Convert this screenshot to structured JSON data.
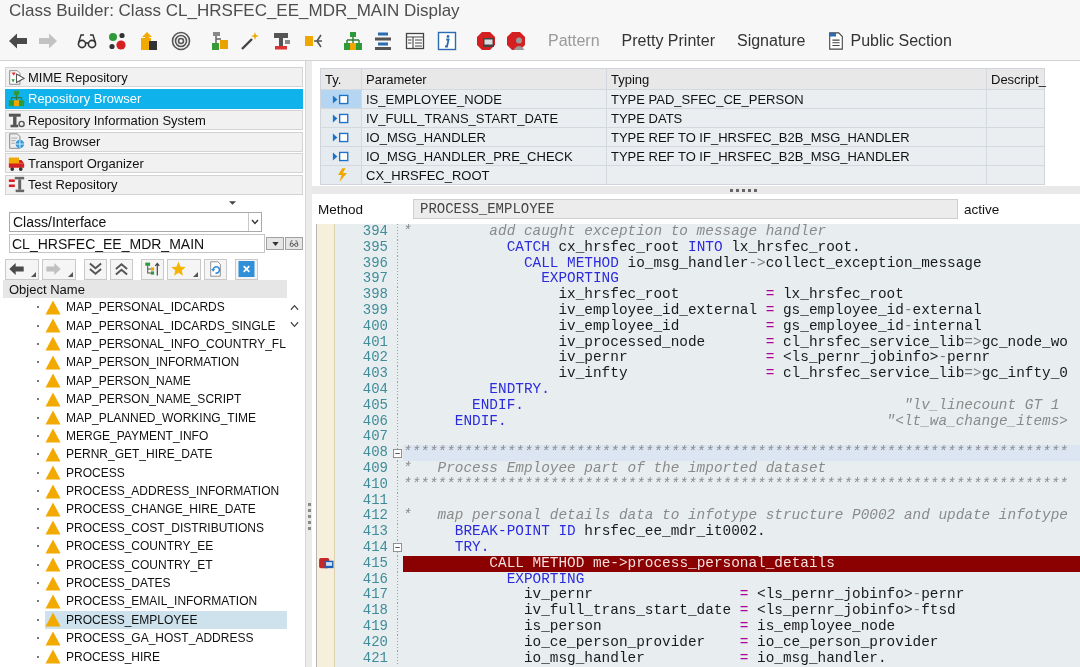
{
  "window": {
    "title": "Class Builder: Class CL_HRSFEC_EE_MDR_MAIN Display"
  },
  "toolbar": [
    {
      "kind": "icon",
      "disabled": false
    },
    {
      "kind": "icon",
      "disabled": true
    },
    {
      "kind": "icon",
      "disabled": false
    },
    {
      "kind": "icon",
      "disabled": false
    },
    {
      "kind": "icon",
      "disabled": false
    },
    {
      "kind": "icon",
      "disabled": false
    },
    {
      "kind": "icon",
      "disabled": false
    },
    {
      "kind": "icon",
      "disabled": false
    },
    {
      "kind": "icon",
      "disabled": false
    },
    {
      "kind": "icon",
      "disabled": false
    },
    {
      "kind": "icon",
      "disabled": false
    },
    {
      "kind": "icon",
      "disabled": false
    },
    {
      "kind": "icon",
      "disabled": false
    },
    {
      "kind": "icon",
      "disabled": false
    },
    {
      "kind": "icon",
      "disabled": false
    },
    {
      "kind": "icon",
      "disabled": false
    },
    {
      "kind": "text",
      "label": "Pattern",
      "disabled": true
    },
    {
      "kind": "text",
      "label": "Pretty Printer",
      "disabled": false
    },
    {
      "kind": "text",
      "label": "Signature",
      "disabled": false
    },
    {
      "kind": "icon-text",
      "label": "Public Section",
      "disabled": false
    }
  ],
  "navigator": {
    "items": [
      {
        "label": "MIME Repository",
        "selected": false
      },
      {
        "label": "Repository Browser",
        "selected": true
      },
      {
        "label": "Repository Information System",
        "selected": false
      },
      {
        "label": "Tag Browser",
        "selected": false
      },
      {
        "label": "Transport Organizer",
        "selected": false
      },
      {
        "label": "Test Repository",
        "selected": false
      }
    ],
    "object_type": "Class/Interface",
    "object_name": "CL_HRSFEC_EE_MDR_MAIN",
    "toolbar": [
      {
        "disabled": false
      },
      {
        "disabled": true
      },
      {
        "disabled": false
      },
      {
        "disabled": false
      },
      {
        "disabled": false
      },
      {
        "disabled": false
      },
      {
        "disabled": false
      },
      {
        "disabled": false
      }
    ]
  },
  "tree": {
    "header": "Object Name",
    "items": [
      {
        "label": "MAP_PERSONAL_IDCARDS",
        "selected": false
      },
      {
        "label": "MAP_PERSONAL_IDCARDS_SINGLE",
        "selected": false
      },
      {
        "label": "MAP_PERSONAL_INFO_COUNTRY_FL",
        "selected": false
      },
      {
        "label": "MAP_PERSON_INFORMATION",
        "selected": false
      },
      {
        "label": "MAP_PERSON_NAME",
        "selected": false
      },
      {
        "label": "MAP_PERSON_NAME_SCRIPT",
        "selected": false
      },
      {
        "label": "MAP_PLANNED_WORKING_TIME",
        "selected": false
      },
      {
        "label": "MERGE_PAYMENT_INFO",
        "selected": false
      },
      {
        "label": "PERNR_GET_HIRE_DATE",
        "selected": false
      },
      {
        "label": "PROCESS",
        "selected": false
      },
      {
        "label": "PROCESS_ADDRESS_INFORMATION",
        "selected": false
      },
      {
        "label": "PROCESS_CHANGE_HIRE_DATE",
        "selected": false
      },
      {
        "label": "PROCESS_COST_DISTRIBUTIONS",
        "selected": false
      },
      {
        "label": "PROCESS_COUNTRY_EE",
        "selected": false
      },
      {
        "label": "PROCESS_COUNTRY_ET",
        "selected": false
      },
      {
        "label": "PROCESS_DATES",
        "selected": false
      },
      {
        "label": "PROCESS_EMAIL_INFORMATION",
        "selected": false
      },
      {
        "label": "PROCESS_EMPLOYEE",
        "selected": true
      },
      {
        "label": "PROCESS_GA_HOST_ADDRESS",
        "selected": false
      },
      {
        "label": "PROCESS_HIRE",
        "selected": false
      }
    ]
  },
  "parameters": {
    "columns": [
      "Ty.",
      "Parameter",
      "Typing",
      "Descript_"
    ],
    "rows": [
      {
        "kind": "importing",
        "selected": true,
        "parameter": "IS_EMPLOYEE_NODE",
        "typing": "TYPE PAD_SFEC_CE_PERSON"
      },
      {
        "kind": "importing",
        "selected": false,
        "parameter": "IV_FULL_TRANS_START_DATE",
        "typing": "TYPE DATS"
      },
      {
        "kind": "importing",
        "selected": false,
        "parameter": "IO_MSG_HANDLER",
        "typing": "TYPE REF TO IF_HRSFEC_B2B_MSG_HANDLER"
      },
      {
        "kind": "importing",
        "selected": false,
        "parameter": "IO_MSG_HANDLER_PRE_CHECK",
        "typing": "TYPE REF TO IF_HRSFEC_B2B_MSG_HANDLER"
      },
      {
        "kind": "exception",
        "selected": false,
        "parameter": "CX_HRSFEC_ROOT"
      }
    ]
  },
  "method": {
    "label": "Method",
    "value": "PROCESS_EMPLOYEE",
    "status": "active"
  },
  "editor": {
    "lines": [
      {
        "number": "394",
        "current": false,
        "breakpoint": false,
        "toggle": false,
        "segments": [
          {
            "kind": "comment",
            "text": "*         add caught exception to message handler"
          }
        ]
      },
      {
        "number": "395",
        "current": false,
        "breakpoint": false,
        "toggle": false,
        "segments": [
          {
            "kind": "keyword",
            "text": "            CATCH"
          },
          {
            "kind": "plain",
            "text": " cx_hrsfec_root "
          },
          {
            "kind": "keyword",
            "text": "INTO"
          },
          {
            "kind": "plain",
            "text": " lx_hrsfec_root."
          }
        ]
      },
      {
        "number": "396",
        "current": false,
        "breakpoint": false,
        "toggle": false,
        "segments": [
          {
            "kind": "keyword",
            "text": "              CALL METHOD"
          },
          {
            "kind": "plain",
            "text": " io_msg_handler"
          },
          {
            "kind": "symbol",
            "text": "->"
          },
          {
            "kind": "plain",
            "text": "collect_exception_message"
          }
        ]
      },
      {
        "number": "397",
        "current": false,
        "breakpoint": false,
        "toggle": false,
        "segments": [
          {
            "kind": "keyword",
            "text": "                EXPORTING"
          }
        ]
      },
      {
        "number": "398",
        "current": false,
        "breakpoint": false,
        "toggle": false,
        "segments": [
          {
            "kind": "plain",
            "text": "                  ix_hrsfec_root          "
          },
          {
            "kind": "operator",
            "text": "="
          },
          {
            "kind": "plain",
            "text": " lx_hrsfec_root"
          }
        ]
      },
      {
        "number": "399",
        "current": false,
        "breakpoint": false,
        "toggle": false,
        "segments": [
          {
            "kind": "plain",
            "text": "                  iv_employee_id_external "
          },
          {
            "kind": "operator",
            "text": "="
          },
          {
            "kind": "plain",
            "text": " gs_employee_id"
          },
          {
            "kind": "symbol",
            "text": "-"
          },
          {
            "kind": "plain",
            "text": "external"
          }
        ]
      },
      {
        "number": "400",
        "current": false,
        "breakpoint": false,
        "toggle": false,
        "segments": [
          {
            "kind": "plain",
            "text": "                  iv_employee_id          "
          },
          {
            "kind": "operator",
            "text": "="
          },
          {
            "kind": "plain",
            "text": " gs_employee_id"
          },
          {
            "kind": "symbol",
            "text": "-"
          },
          {
            "kind": "plain",
            "text": "internal"
          }
        ]
      },
      {
        "number": "401",
        "current": false,
        "breakpoint": false,
        "toggle": false,
        "segments": [
          {
            "kind": "plain",
            "text": "                  iv_processed_node       "
          },
          {
            "kind": "operator",
            "text": "="
          },
          {
            "kind": "plain",
            "text": " cl_hrsfec_service_lib"
          },
          {
            "kind": "symbol",
            "text": "=>"
          },
          {
            "kind": "plain",
            "text": "gc_node_wo"
          }
        ]
      },
      {
        "number": "402",
        "current": false,
        "breakpoint": false,
        "toggle": false,
        "segments": [
          {
            "kind": "plain",
            "text": "                  iv_pernr                "
          },
          {
            "kind": "operator",
            "text": "="
          },
          {
            "kind": "plain",
            "text": " <ls_pernr_jobinfo>"
          },
          {
            "kind": "symbol",
            "text": "-"
          },
          {
            "kind": "plain",
            "text": "pernr"
          }
        ]
      },
      {
        "number": "403",
        "current": false,
        "breakpoint": false,
        "toggle": false,
        "segments": [
          {
            "kind": "plain",
            "text": "                  iv_infty                "
          },
          {
            "kind": "operator",
            "text": "="
          },
          {
            "kind": "plain",
            "text": " cl_hrsfec_service_lib"
          },
          {
            "kind": "symbol",
            "text": "=>"
          },
          {
            "kind": "plain",
            "text": "gc_infty_0"
          }
        ]
      },
      {
        "number": "404",
        "current": false,
        "breakpoint": false,
        "toggle": false,
        "segments": [
          {
            "kind": "keyword",
            "text": "          ENDTRY."
          }
        ]
      },
      {
        "number": "405",
        "current": false,
        "breakpoint": false,
        "toggle": false,
        "segments": [
          {
            "kind": "keyword",
            "text": "        ENDIF."
          },
          {
            "kind": "comment",
            "text": "                                            \"lv_linecount GT 1"
          }
        ]
      },
      {
        "number": "406",
        "current": false,
        "breakpoint": false,
        "toggle": false,
        "segments": [
          {
            "kind": "keyword",
            "text": "      ENDIF."
          },
          {
            "kind": "comment",
            "text": "                                            \"<lt_wa_change_items>"
          }
        ]
      },
      {
        "number": "407",
        "current": false,
        "breakpoint": false,
        "toggle": false
      },
      {
        "number": "408",
        "current": true,
        "breakpoint": false,
        "toggle": true,
        "segments": [
          {
            "kind": "comment",
            "text": "*****************************************************************************"
          }
        ]
      },
      {
        "number": "409",
        "current": false,
        "breakpoint": false,
        "toggle": false,
        "segments": [
          {
            "kind": "comment",
            "text": "*   Process Employee part of the imported dataset"
          }
        ]
      },
      {
        "number": "410",
        "current": false,
        "breakpoint": false,
        "toggle": false,
        "segments": [
          {
            "kind": "comment",
            "text": "*****************************************************************************"
          }
        ]
      },
      {
        "number": "411",
        "current": false,
        "breakpoint": false,
        "toggle": false
      },
      {
        "number": "412",
        "current": false,
        "breakpoint": false,
        "toggle": false,
        "segments": [
          {
            "kind": "comment",
            "text": "*   map personal details data to infotype structure P0002 and update infotype"
          }
        ]
      },
      {
        "number": "413",
        "current": false,
        "breakpoint": false,
        "toggle": false,
        "segments": [
          {
            "kind": "keyword",
            "text": "      BREAK-POINT ID"
          },
          {
            "kind": "plain",
            "text": " hrsfec_ee_mdr_it0002."
          }
        ]
      },
      {
        "number": "414",
        "current": false,
        "breakpoint": false,
        "toggle": true,
        "segments": [
          {
            "kind": "keyword",
            "text": "      TRY."
          }
        ]
      },
      {
        "number": "415",
        "current": false,
        "breakpoint": true,
        "toggle": false,
        "segments": [
          {
            "kind": "keyword",
            "text": "          CALL METHOD"
          },
          {
            "kind": "plain",
            "text": " me"
          },
          {
            "kind": "symbol",
            "text": "->"
          },
          {
            "kind": "plain",
            "text": "process_personal_details"
          }
        ]
      },
      {
        "number": "416",
        "current": false,
        "breakpoint": false,
        "toggle": false,
        "segments": [
          {
            "kind": "keyword",
            "text": "            EXPORTING"
          }
        ]
      },
      {
        "number": "417",
        "current": false,
        "breakpoint": false,
        "toggle": false,
        "segments": [
          {
            "kind": "plain",
            "text": "              iv_pernr                 "
          },
          {
            "kind": "operator",
            "text": "="
          },
          {
            "kind": "plain",
            "text": " <ls_pernr_jobinfo>"
          },
          {
            "kind": "symbol",
            "text": "-"
          },
          {
            "kind": "plain",
            "text": "pernr"
          }
        ]
      },
      {
        "number": "418",
        "current": false,
        "breakpoint": false,
        "toggle": false,
        "segments": [
          {
            "kind": "plain",
            "text": "              iv_full_trans_start_date "
          },
          {
            "kind": "operator",
            "text": "="
          },
          {
            "kind": "plain",
            "text": " <ls_pernr_jobinfo>"
          },
          {
            "kind": "symbol",
            "text": "-"
          },
          {
            "kind": "plain",
            "text": "ftsd"
          }
        ]
      },
      {
        "number": "419",
        "current": false,
        "breakpoint": false,
        "toggle": false,
        "segments": [
          {
            "kind": "plain",
            "text": "              is_person                "
          },
          {
            "kind": "operator",
            "text": "="
          },
          {
            "kind": "plain",
            "text": " is_employee_node"
          }
        ]
      },
      {
        "number": "420",
        "current": false,
        "breakpoint": false,
        "toggle": false,
        "segments": [
          {
            "kind": "plain",
            "text": "              io_ce_person_provider    "
          },
          {
            "kind": "operator",
            "text": "="
          },
          {
            "kind": "plain",
            "text": " io_ce_person_provider"
          }
        ]
      },
      {
        "number": "421",
        "current": false,
        "breakpoint": false,
        "toggle": false,
        "segments": [
          {
            "kind": "plain",
            "text": "              io_msg_handler           "
          },
          {
            "kind": "operator",
            "text": "="
          },
          {
            "kind": "plain",
            "text": " io_msg_handler."
          }
        ]
      }
    ]
  }
}
